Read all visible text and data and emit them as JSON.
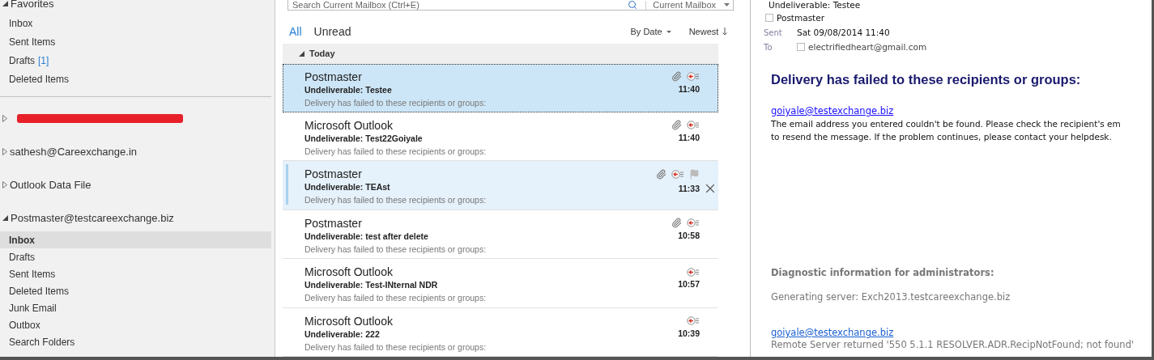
{
  "sidebar": {
    "favorites": {
      "title": "Favorites",
      "expanded": true,
      "items": [
        {
          "label": "Inbox",
          "selected": false
        },
        {
          "label": "Sent Items",
          "selected": false
        },
        {
          "label": "Drafts",
          "count": "[1]",
          "selected": false
        },
        {
          "label": "Deleted Items",
          "selected": false
        }
      ]
    },
    "accounts": [
      {
        "kind": "redacted",
        "expanded": false
      },
      {
        "kind": "account",
        "name": "sathesh@Careexchange.in",
        "expanded": false
      },
      {
        "kind": "account",
        "name": "Outlook Data File",
        "expanded": false
      },
      {
        "kind": "account",
        "name": "Postmaster@testcareexchange.biz",
        "expanded": true,
        "folders": [
          {
            "label": "Inbox",
            "selected": true
          },
          {
            "label": "Drafts",
            "selected": false
          },
          {
            "label": "Sent Items",
            "selected": false
          },
          {
            "label": "Deleted Items",
            "selected": false
          },
          {
            "label": "Junk Email",
            "selected": false
          },
          {
            "label": "Outbox",
            "selected": false
          },
          {
            "label": "Search Folders",
            "selected": false
          }
        ]
      }
    ]
  },
  "search": {
    "placeholder": "Search Current Mailbox (Ctrl+E)",
    "scope": "Current Mailbox"
  },
  "filters": [
    {
      "label": "All",
      "selected": true
    },
    {
      "label": "Unread",
      "selected": false
    }
  ],
  "sort": {
    "by": "By Date",
    "order": "Newest"
  },
  "group": {
    "label": "Today",
    "expanded": true
  },
  "messages": [
    {
      "sender": "Postmaster",
      "subject": "Undeliverable: Testee",
      "preview": "Delivery has failed to these recipients or groups:",
      "time": "11:40",
      "attachment": true,
      "selected": true,
      "hovered": false
    },
    {
      "sender": "Microsoft Outlook",
      "subject": "Undeliverable: Test22Goiyale",
      "preview": "Delivery has failed to these recipients or groups:",
      "time": "11:40",
      "attachment": true,
      "selected": false,
      "hovered": false
    },
    {
      "sender": "Postmaster",
      "subject": "Undeliverable: TEAst",
      "preview": "Delivery has failed to these recipients or groups:",
      "time": "11:33",
      "attachment": true,
      "selected": false,
      "hovered": true
    },
    {
      "sender": "Postmaster",
      "subject": "Undeliverable: test after delete",
      "preview": "Delivery has failed to these recipients or groups:",
      "time": "10:58",
      "attachment": true,
      "selected": false,
      "hovered": false
    },
    {
      "sender": "Microsoft Outlook",
      "subject": "Undeliverable: Test-INternal NDR",
      "preview": "Delivery has failed to these recipients or groups:",
      "time": "10:57",
      "attachment": false,
      "selected": false,
      "hovered": false
    },
    {
      "sender": "Microsoft Outlook",
      "subject": "Undeliverable: 222",
      "preview": "Delivery has failed to these recipients or groups:",
      "time": "10:39",
      "attachment": false,
      "selected": false,
      "hovered": false
    }
  ],
  "reading": {
    "subject": "Undeliverable: Testee",
    "from": "Postmaster",
    "sent_label": "Sent",
    "sent": "Sat 09/08/2014 11:40",
    "to_label": "To",
    "to": "electrifiedheart@gmail.com",
    "heading": "Delivery has failed to these recipients or groups:",
    "recipient": "goiyale@testexchange.biz",
    "message_lines": [
      "The email address you entered couldn't be found. Please check the recipient's em",
      "to resend the message. If the problem continues, please contact your helpdesk."
    ],
    "diagnostic_heading": "Diagnostic information for administrators:",
    "generating_server": "Generating server: Exch2013.testcareexchange.biz",
    "diagnostic_recipient": "goiyale@testexchange.biz",
    "remote_server": "Remote Server returned '550 5.1.1 RESOLVER.ADR.RecipNotFound; not found'"
  }
}
